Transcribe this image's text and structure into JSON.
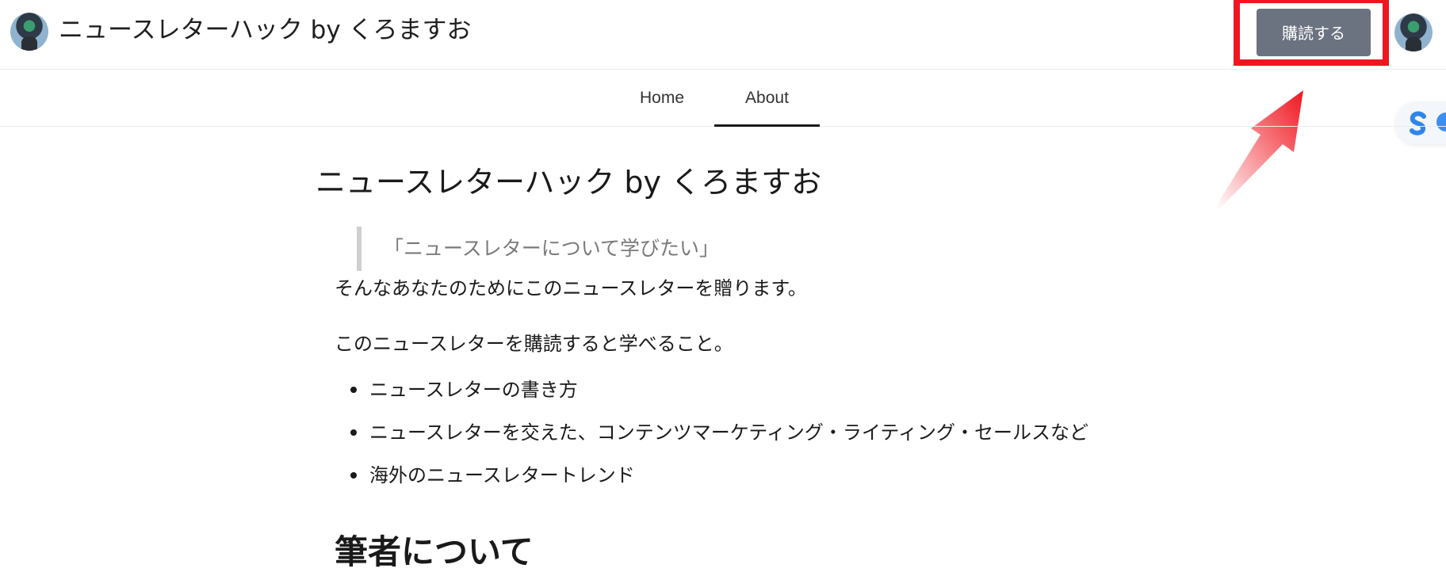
{
  "header": {
    "site_title": "ニュースレターハック by くろますお",
    "subscribe_label": "購読する"
  },
  "nav": {
    "tabs": [
      {
        "label": "Home",
        "active": false
      },
      {
        "label": "About",
        "active": true
      }
    ]
  },
  "main": {
    "title": "ニュースレターハック by くろますお",
    "quote": "「ニュースレターについて学びたい」",
    "intro": "そんなあなたのためにこのニュースレターを贈ります。",
    "learn_heading": "このニュースレターを購読すると学べること。",
    "features": [
      "ニュースレターの書き方",
      "ニュースレターを交えた、コンテンツマーケティング・ライティング・セールスなど",
      "海外のニュースレタートレンド"
    ],
    "next_heading": "筆者について"
  },
  "colors": {
    "subscribe_bg": "#6b7280",
    "highlight": "#f0151f",
    "active_tab_underline": "#1a1a1a"
  },
  "icons": {
    "floating_widget": "s-logo-icon"
  }
}
